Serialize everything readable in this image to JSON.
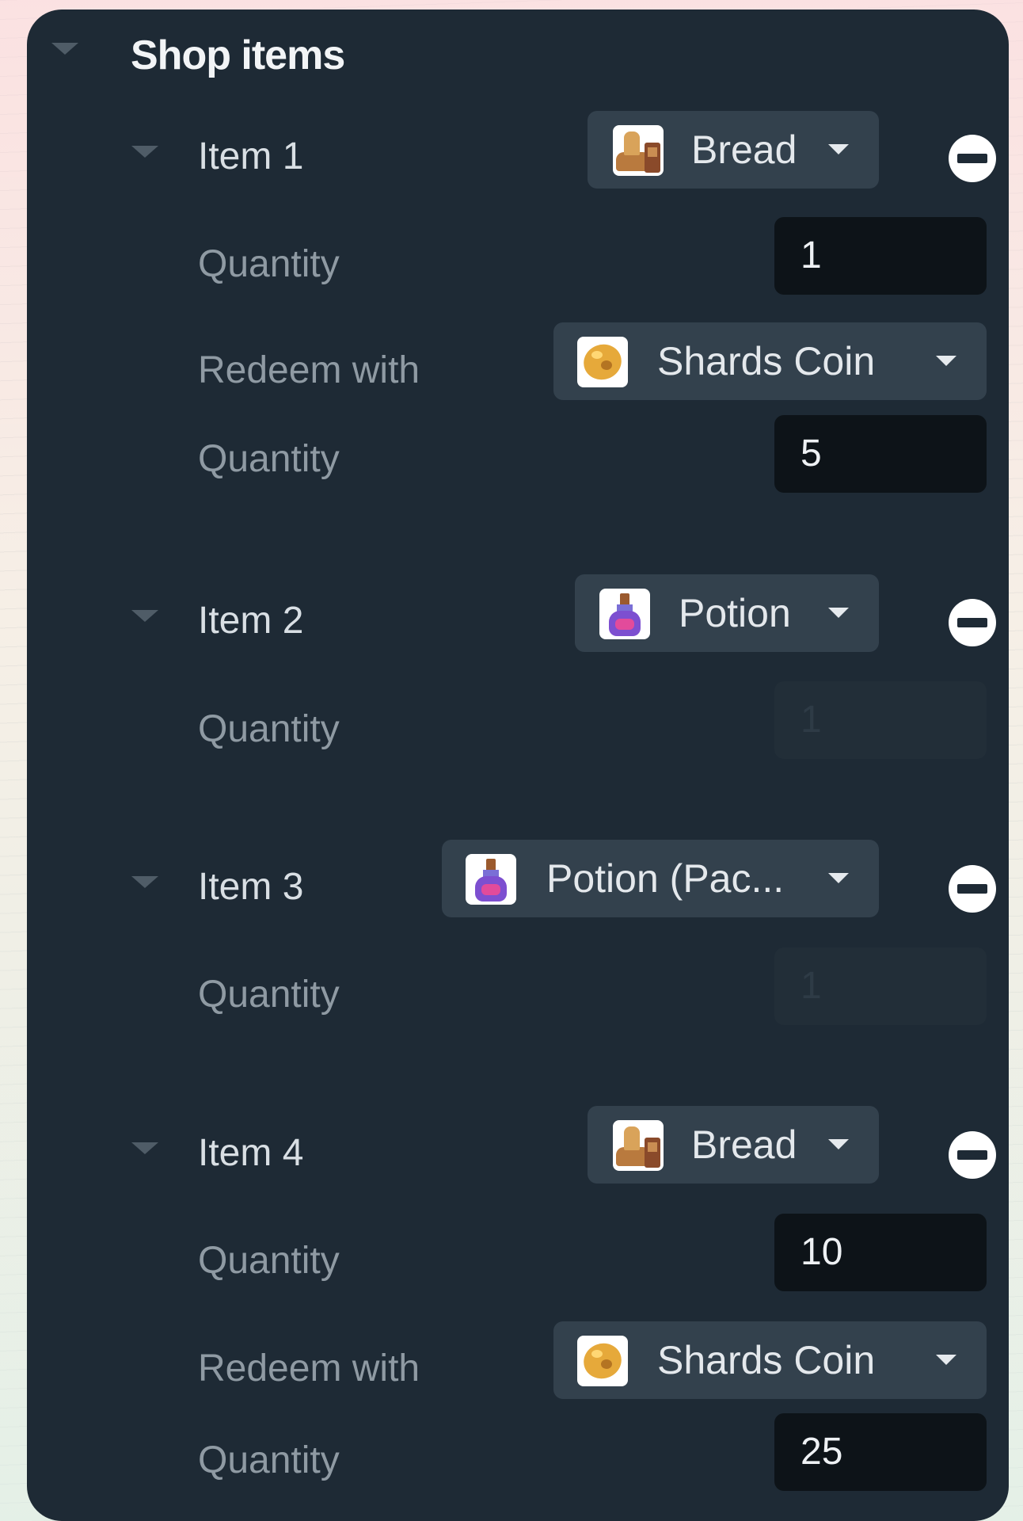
{
  "panel": {
    "title": "Shop items"
  },
  "items": [
    {
      "label": "Item 1",
      "select": {
        "label": "Bread",
        "icon": "bread-icon"
      },
      "quantity_label": "Quantity",
      "quantity": "1",
      "redeem": {
        "label": "Redeem with",
        "select": {
          "label": "Shards Coin",
          "icon": "coin-icon"
        },
        "quantity_label": "Quantity",
        "quantity": "5"
      }
    },
    {
      "label": "Item 2",
      "select": {
        "label": "Potion",
        "icon": "potion-icon"
      },
      "quantity_label": "Quantity",
      "quantity": "1",
      "quantity_disabled": true
    },
    {
      "label": "Item 3",
      "select": {
        "label": "Potion (Pac...",
        "icon": "potion-icon"
      },
      "quantity_label": "Quantity",
      "quantity": "1",
      "quantity_disabled": true
    },
    {
      "label": "Item 4",
      "select": {
        "label": "Bread",
        "icon": "bread-icon"
      },
      "quantity_label": "Quantity",
      "quantity": "10",
      "redeem": {
        "label": "Redeem with",
        "select": {
          "label": "Shards Coin",
          "icon": "coin-icon"
        },
        "quantity_label": "Quantity",
        "quantity": "25"
      }
    }
  ],
  "colors": {
    "panel_bg": "#1e2a35",
    "dropdown_bg": "#33414d",
    "input_bg": "#0d1318",
    "input_disabled_bg": "#222e38",
    "label_color": "#8f9aa3"
  }
}
